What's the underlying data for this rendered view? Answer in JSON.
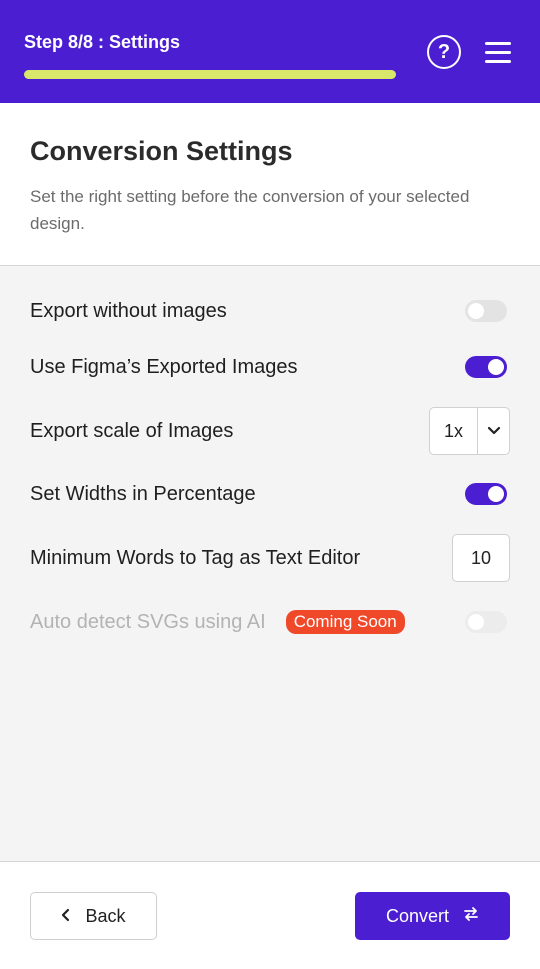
{
  "topbar": {
    "step_title": "Step 8/8 : Settings",
    "progress": 1.0,
    "help_icon": "question-mark-icon",
    "menu_icon": "hamburger-menu-icon"
  },
  "header": {
    "title": "Conversion Settings",
    "subtitle": "Set the right setting before the conversion of your selected design."
  },
  "settings": [
    {
      "label": "Export without images",
      "type": "toggle",
      "value": false,
      "disabled": false
    },
    {
      "label": "Use Figma’s Exported Images",
      "type": "toggle",
      "value": true,
      "disabled": false
    },
    {
      "label": "Export scale of Images",
      "type": "select",
      "value": "1x"
    },
    {
      "label": "Set Widths in Percentage",
      "type": "toggle",
      "value": true,
      "disabled": false
    },
    {
      "label": "Minimum Words to Tag as Text Editor",
      "type": "number",
      "value": "10"
    },
    {
      "label": "Auto detect SVGs using AI",
      "type": "toggle",
      "value": false,
      "disabled": true,
      "badge": "Coming Soon"
    }
  ],
  "footer": {
    "back_label": "Back",
    "back_icon": "chevron-left-icon",
    "convert_label": "Convert",
    "convert_icon": "swap-arrows-icon"
  },
  "colors": {
    "brand": "#4b1fd1",
    "progress": "#d9e86a",
    "badge": "#f0492a"
  }
}
